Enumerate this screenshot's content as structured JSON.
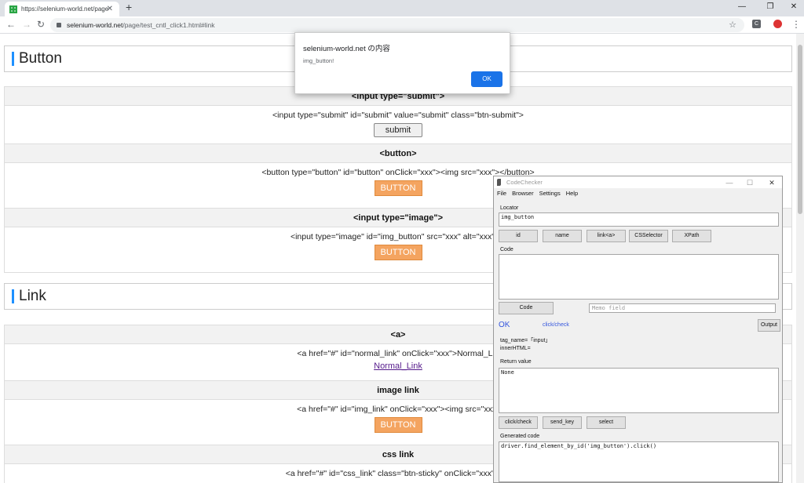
{
  "browser": {
    "tab_title": "https://selenium-world.net/page",
    "tab_close": "✕",
    "new_tab": "+",
    "url_host": "selenium-world.net",
    "url_path": "/page/test_cntl_click1.html#link",
    "ext_icon_label": "C"
  },
  "page": {
    "button_section_title": "Button",
    "link_section_title": "Link",
    "button_rows": [
      {
        "header": "<input type=\"submit\">",
        "code": "<input type=\"submit\" id=\"submit\" value=\"submit\" class=\"btn-submit\">",
        "control": "submit"
      },
      {
        "header": "<button>",
        "code": "<button type=\"button\" id=\"button\" onClick=\"xxx\"><img src=\"xxx\"></button>",
        "control": "BUTTON"
      },
      {
        "header": "<input type=\"image\">",
        "code": "<input type=\"image\" id=\"img_button\" src=\"xxx\" alt=\"xxx\" va",
        "control": "BUTTON"
      }
    ],
    "link_rows": [
      {
        "header": "<a>",
        "code": "<a href=\"#\" id=\"normal_link\" onClick=\"xxx\">Normal_Lin",
        "control": "Normal_Link"
      },
      {
        "header": "image link",
        "code": "<a href=\"#\" id=\"img_link\" onClick=\"xxx\"><img src=\"xxx\"",
        "control": "BUTTON"
      },
      {
        "header": "css link",
        "code": "<a href=\"#\" id=\"css_link\" class=\"btn-sticky\" onClick=\"xxx\">CS"
      }
    ]
  },
  "alert": {
    "title": "selenium-world.net の内容",
    "message": "img_button!",
    "ok_label": "OK"
  },
  "codechecker": {
    "title": "CodeChecker",
    "menu": [
      "File",
      "Browser",
      "Settings",
      "Help"
    ],
    "locator_label": "Locator",
    "locator_value": "img_button",
    "locator_buttons": [
      "id",
      "name",
      "link<a>",
      "CSSelector",
      "XPath"
    ],
    "code_label": "Code",
    "code_button": "Code",
    "memo_placeholder": "Memo field",
    "status": "OK",
    "action": "click/check",
    "output_button": "Output",
    "tag_name": "tag_name=「input」",
    "inner_html": "innerHTML=",
    "return_label": "Return value",
    "return_value": "None",
    "action_buttons": [
      "click/check",
      "send_key",
      "select"
    ],
    "generated_label": "Generated code",
    "generated_code": "driver.find_element_by_id('img_button').click()"
  }
}
